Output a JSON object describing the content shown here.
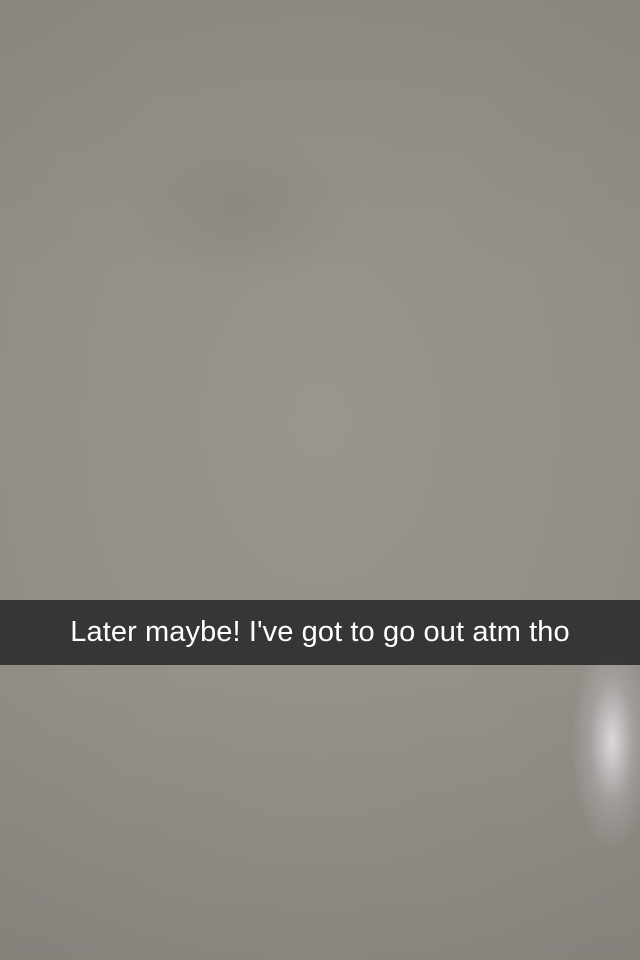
{
  "snap": {
    "caption": "Later maybe! I've got to go out atm tho",
    "background_color": "#958f89",
    "caption_bar_color": "#222222",
    "caption_text_color": "#ffffff"
  }
}
